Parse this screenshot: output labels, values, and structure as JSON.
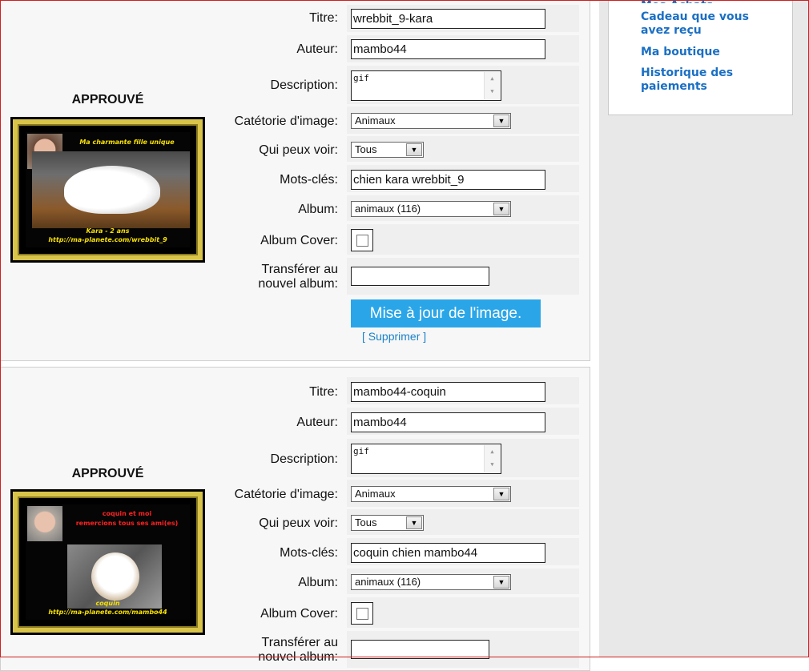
{
  "sidebar": {
    "clipped_link": "Mes Achats",
    "links": [
      "Cadeau que vous avez reçu",
      "Ma boutique",
      "Historique des paiements"
    ]
  },
  "labels": {
    "title": "Titre:",
    "author": "Auteur:",
    "description": "Description:",
    "category": "Catétorie d'image:",
    "visibility": "Qui peux voir:",
    "keywords": "Mots-clés:",
    "album": "Album:",
    "album_cover": "Album Cover:",
    "move_line1": "Transférer au",
    "move_line2": "nouvel album:"
  },
  "images": [
    {
      "status": "APPROUVÉ",
      "thumb_top_text": "Ma charmante fille unique",
      "thumb_bottom_line1": "Kara - 2 ans",
      "thumb_bottom_line2": "http://ma-planete.com/wrebbit_9",
      "title": "wrebbit_9-kara",
      "author": "mambo44",
      "description": "gif",
      "category": "Animaux",
      "visibility": "Tous",
      "keywords": "chien kara wrebbit_9",
      "album": "animaux (116)",
      "album_cover": false,
      "move_to": "",
      "update_label": "Mise à jour de l'image.",
      "delete_label": "[ Supprimer ]"
    },
    {
      "status": "APPROUVÉ",
      "thumb_top_line1": "coquin et moi",
      "thumb_top_line2": "remercions tous ses ami(es)",
      "thumb_bottom_line1": "coquin",
      "thumb_bottom_line2": "http://ma-planete.com/mambo44",
      "title": "mambo44-coquin",
      "author": "mambo44",
      "description": "gif",
      "category": "Animaux",
      "visibility": "Tous",
      "keywords": "coquin chien mambo44",
      "album": "animaux (116)",
      "album_cover": false,
      "move_to": ""
    }
  ],
  "colors": {
    "link": "#1a6fc4",
    "button": "#2aa6e8",
    "frame": "#d02020"
  }
}
